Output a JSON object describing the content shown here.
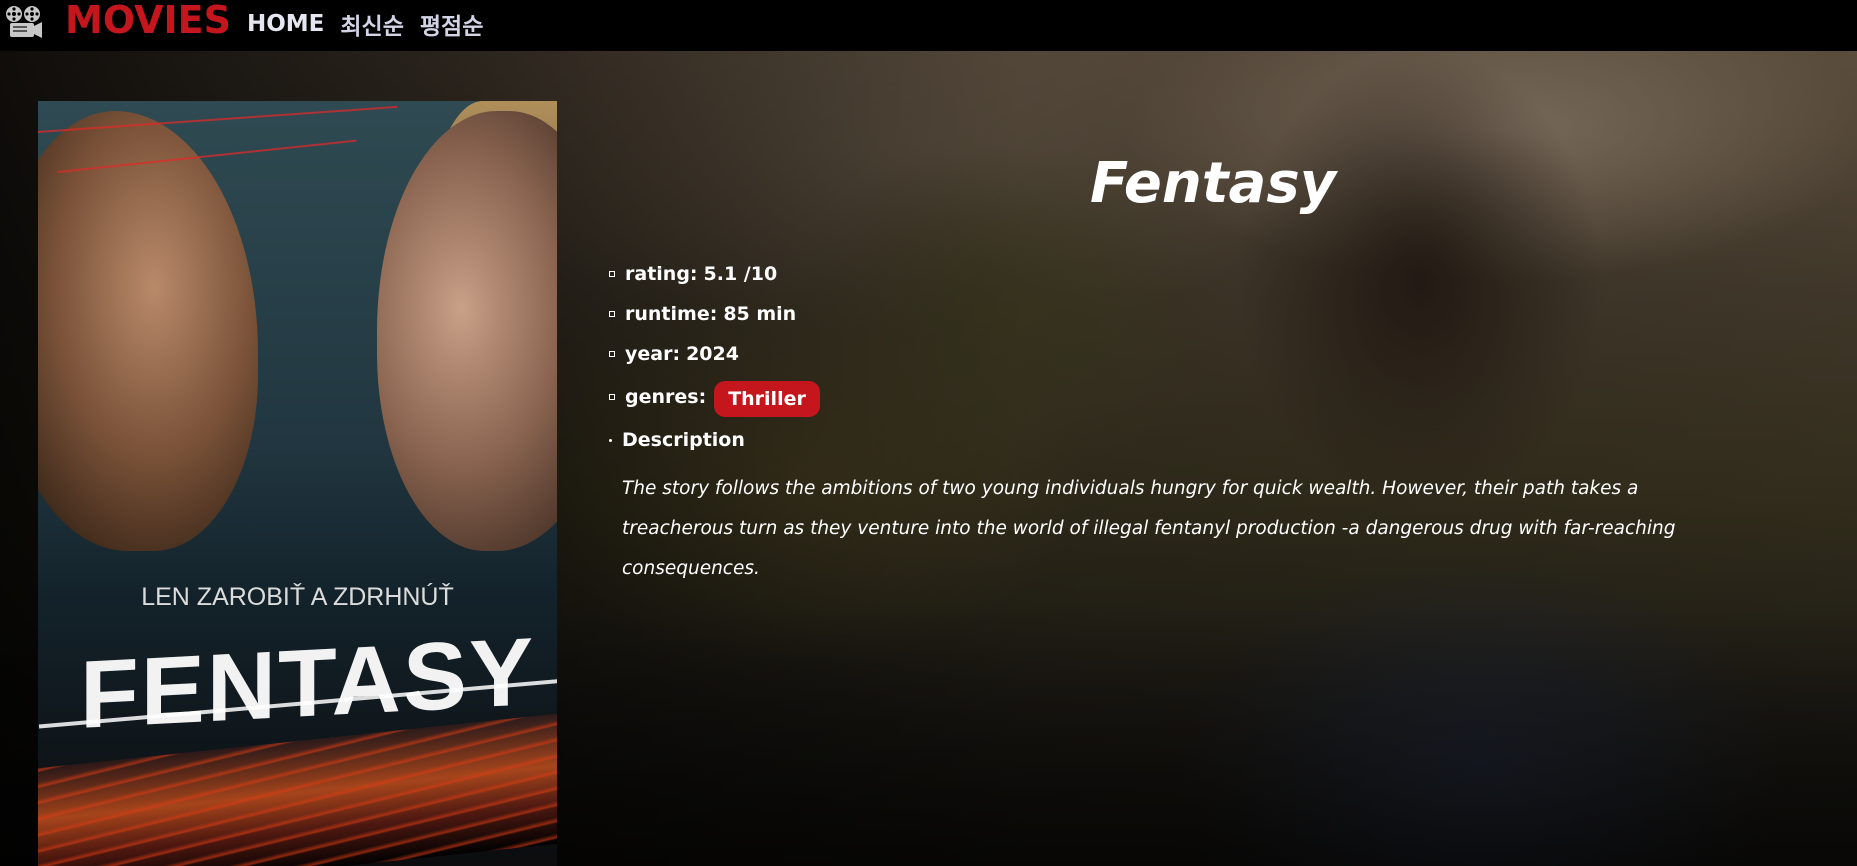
{
  "navbar": {
    "logo_icon": "film-reel-icon",
    "brand": "MOVIES",
    "links": [
      "HOME",
      "최신순",
      "평점순"
    ]
  },
  "poster": {
    "tagline": "LEN ZAROBIŤ A ZDRHNÚŤ",
    "title": "FENTASY"
  },
  "movie": {
    "title": "Fentasy",
    "rating_label": "rating:",
    "rating_value": "5.1 /10",
    "runtime_label": "runtime:",
    "runtime_value": "85 min",
    "year_label": "year:",
    "year_value": "2024",
    "genres_label": "genres:",
    "genres": [
      "Thriller"
    ],
    "description_label": "Description",
    "description": "The story follows the ambitions of two young individuals hungry for quick wealth. However, their path takes a treacherous turn as they venture into the world of illegal fentanyl production -a dangerous drug with far-reaching consequences."
  },
  "colors": {
    "brand": "#c4161c",
    "genre_badge": "#c4161c",
    "navbar_bg": "#000000",
    "text": "#ffffff"
  }
}
